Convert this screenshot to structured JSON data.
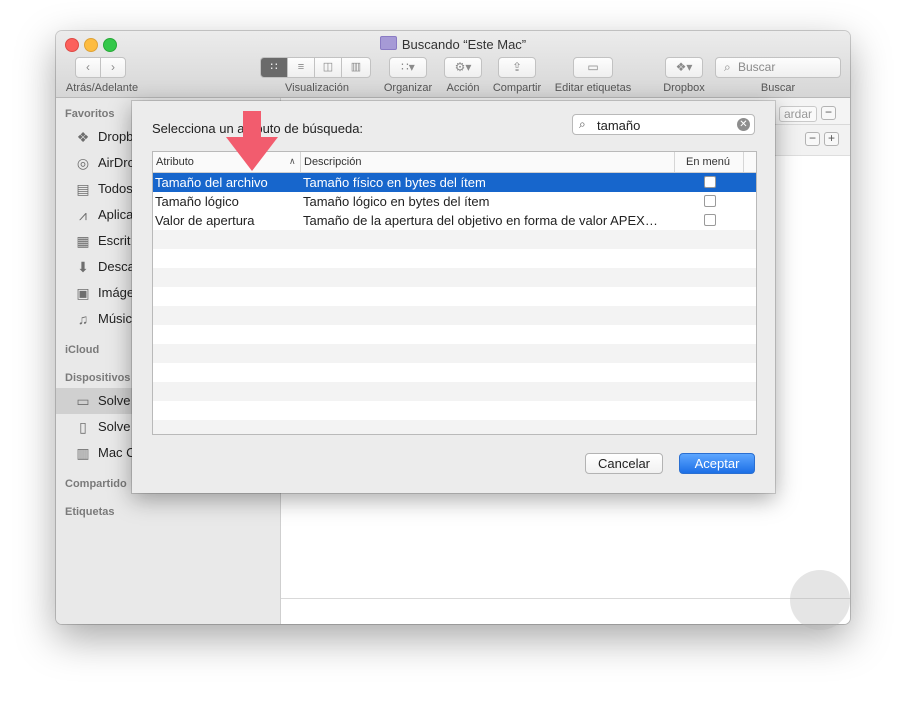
{
  "window": {
    "title": "Buscando “Este Mac”"
  },
  "toolbar": {
    "back_forward_label": "Atrás/Adelante",
    "view_label": "Visualización",
    "arrange_label": "Organizar",
    "action_label": "Acción",
    "share_label": "Compartir",
    "edit_tags_label": "Editar etiquetas",
    "dropbox_label": "Dropbox",
    "search_label": "Buscar",
    "search_placeholder": "Buscar"
  },
  "sidebar": {
    "favorites_heading": "Favoritos",
    "favorites": [
      {
        "label": "Dropb",
        "icon": "dropbox-icon"
      },
      {
        "label": "AirDro",
        "icon": "airdrop-icon"
      },
      {
        "label": "Todos",
        "icon": "all-files-icon"
      },
      {
        "label": "Aplica",
        "icon": "applications-icon"
      },
      {
        "label": "Escrit",
        "icon": "desktop-icon"
      },
      {
        "label": "Desca",
        "icon": "downloads-icon"
      },
      {
        "label": "Imáge",
        "icon": "camera-icon"
      },
      {
        "label": "Músic",
        "icon": "music-icon"
      }
    ],
    "icloud_heading": "iCloud",
    "devices_heading": "Dispositivos",
    "devices": [
      {
        "label": "Solve",
        "icon": "laptop-icon"
      },
      {
        "label": "Solve",
        "icon": "disk-icon"
      },
      {
        "label": "Mac C",
        "icon": "drive-icon"
      }
    ],
    "shared_heading": "Compartido",
    "tags_heading": "Etiquetas"
  },
  "background": {
    "save_button_partial": "ardar"
  },
  "dialog": {
    "prompt": "Selecciona un atributo de búsqueda:",
    "search_value": "tamaño",
    "columns": {
      "attribute": "Atributo",
      "description": "Descripción",
      "in_menu": "En menú"
    },
    "rows": [
      {
        "attribute": "Tamaño del archivo",
        "description": "Tamaño físico en bytes del ítem",
        "in_menu": false
      },
      {
        "attribute": "Tamaño lógico",
        "description": "Tamaño lógico en bytes del ítem",
        "in_menu": false
      },
      {
        "attribute": "Valor de apertura",
        "description": "Tamaño de la apertura del objetivo en forma de valor APEX…",
        "in_menu": false
      }
    ],
    "cancel_label": "Cancelar",
    "accept_label": "Aceptar"
  },
  "colors": {
    "selection": "#1766cc",
    "accent_button": "#1c6fe6",
    "annotation_arrow": "#f25c6e"
  }
}
